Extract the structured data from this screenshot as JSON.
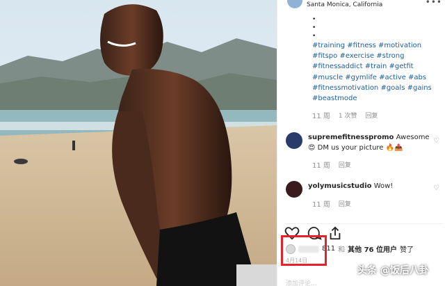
{
  "post": {
    "location": "Santa Monica, California",
    "caption_bullets": [
      "•",
      "•",
      "•"
    ],
    "hashtags": "#training #fitness #motivation #fitspo #exercise #strong #fitnessaddict #train #getfit #muscle #gymlife #active #abs #fitnessmotivation #goals #gains #beastmode",
    "caption_meta": {
      "time": "11 周",
      "likes": "1 次赞",
      "reply": "回复"
    }
  },
  "comments": [
    {
      "user": "supremefitnesspromo",
      "text": "Awesome",
      "text2": "DM us your picture",
      "time": "11 周",
      "reply": "回复"
    },
    {
      "user": "yolymusicstudio",
      "text": "Wow!",
      "time": "11 周",
      "reply": "回复"
    }
  ],
  "likes": {
    "name_suffix": "811",
    "and": "和",
    "others": "其他 76 位用户",
    "liked": "赞了"
  },
  "date_small": "4月14日",
  "add_comment": "添加评论…",
  "watermark": "头条 @饭后八卦",
  "icons": [
    "heart-icon",
    "comment-icon",
    "share-icon",
    "more-icon"
  ],
  "colors": {
    "hashtag": "#1c5c9c",
    "highlight": "#e8202a",
    "meta": "#8e8e8e"
  }
}
